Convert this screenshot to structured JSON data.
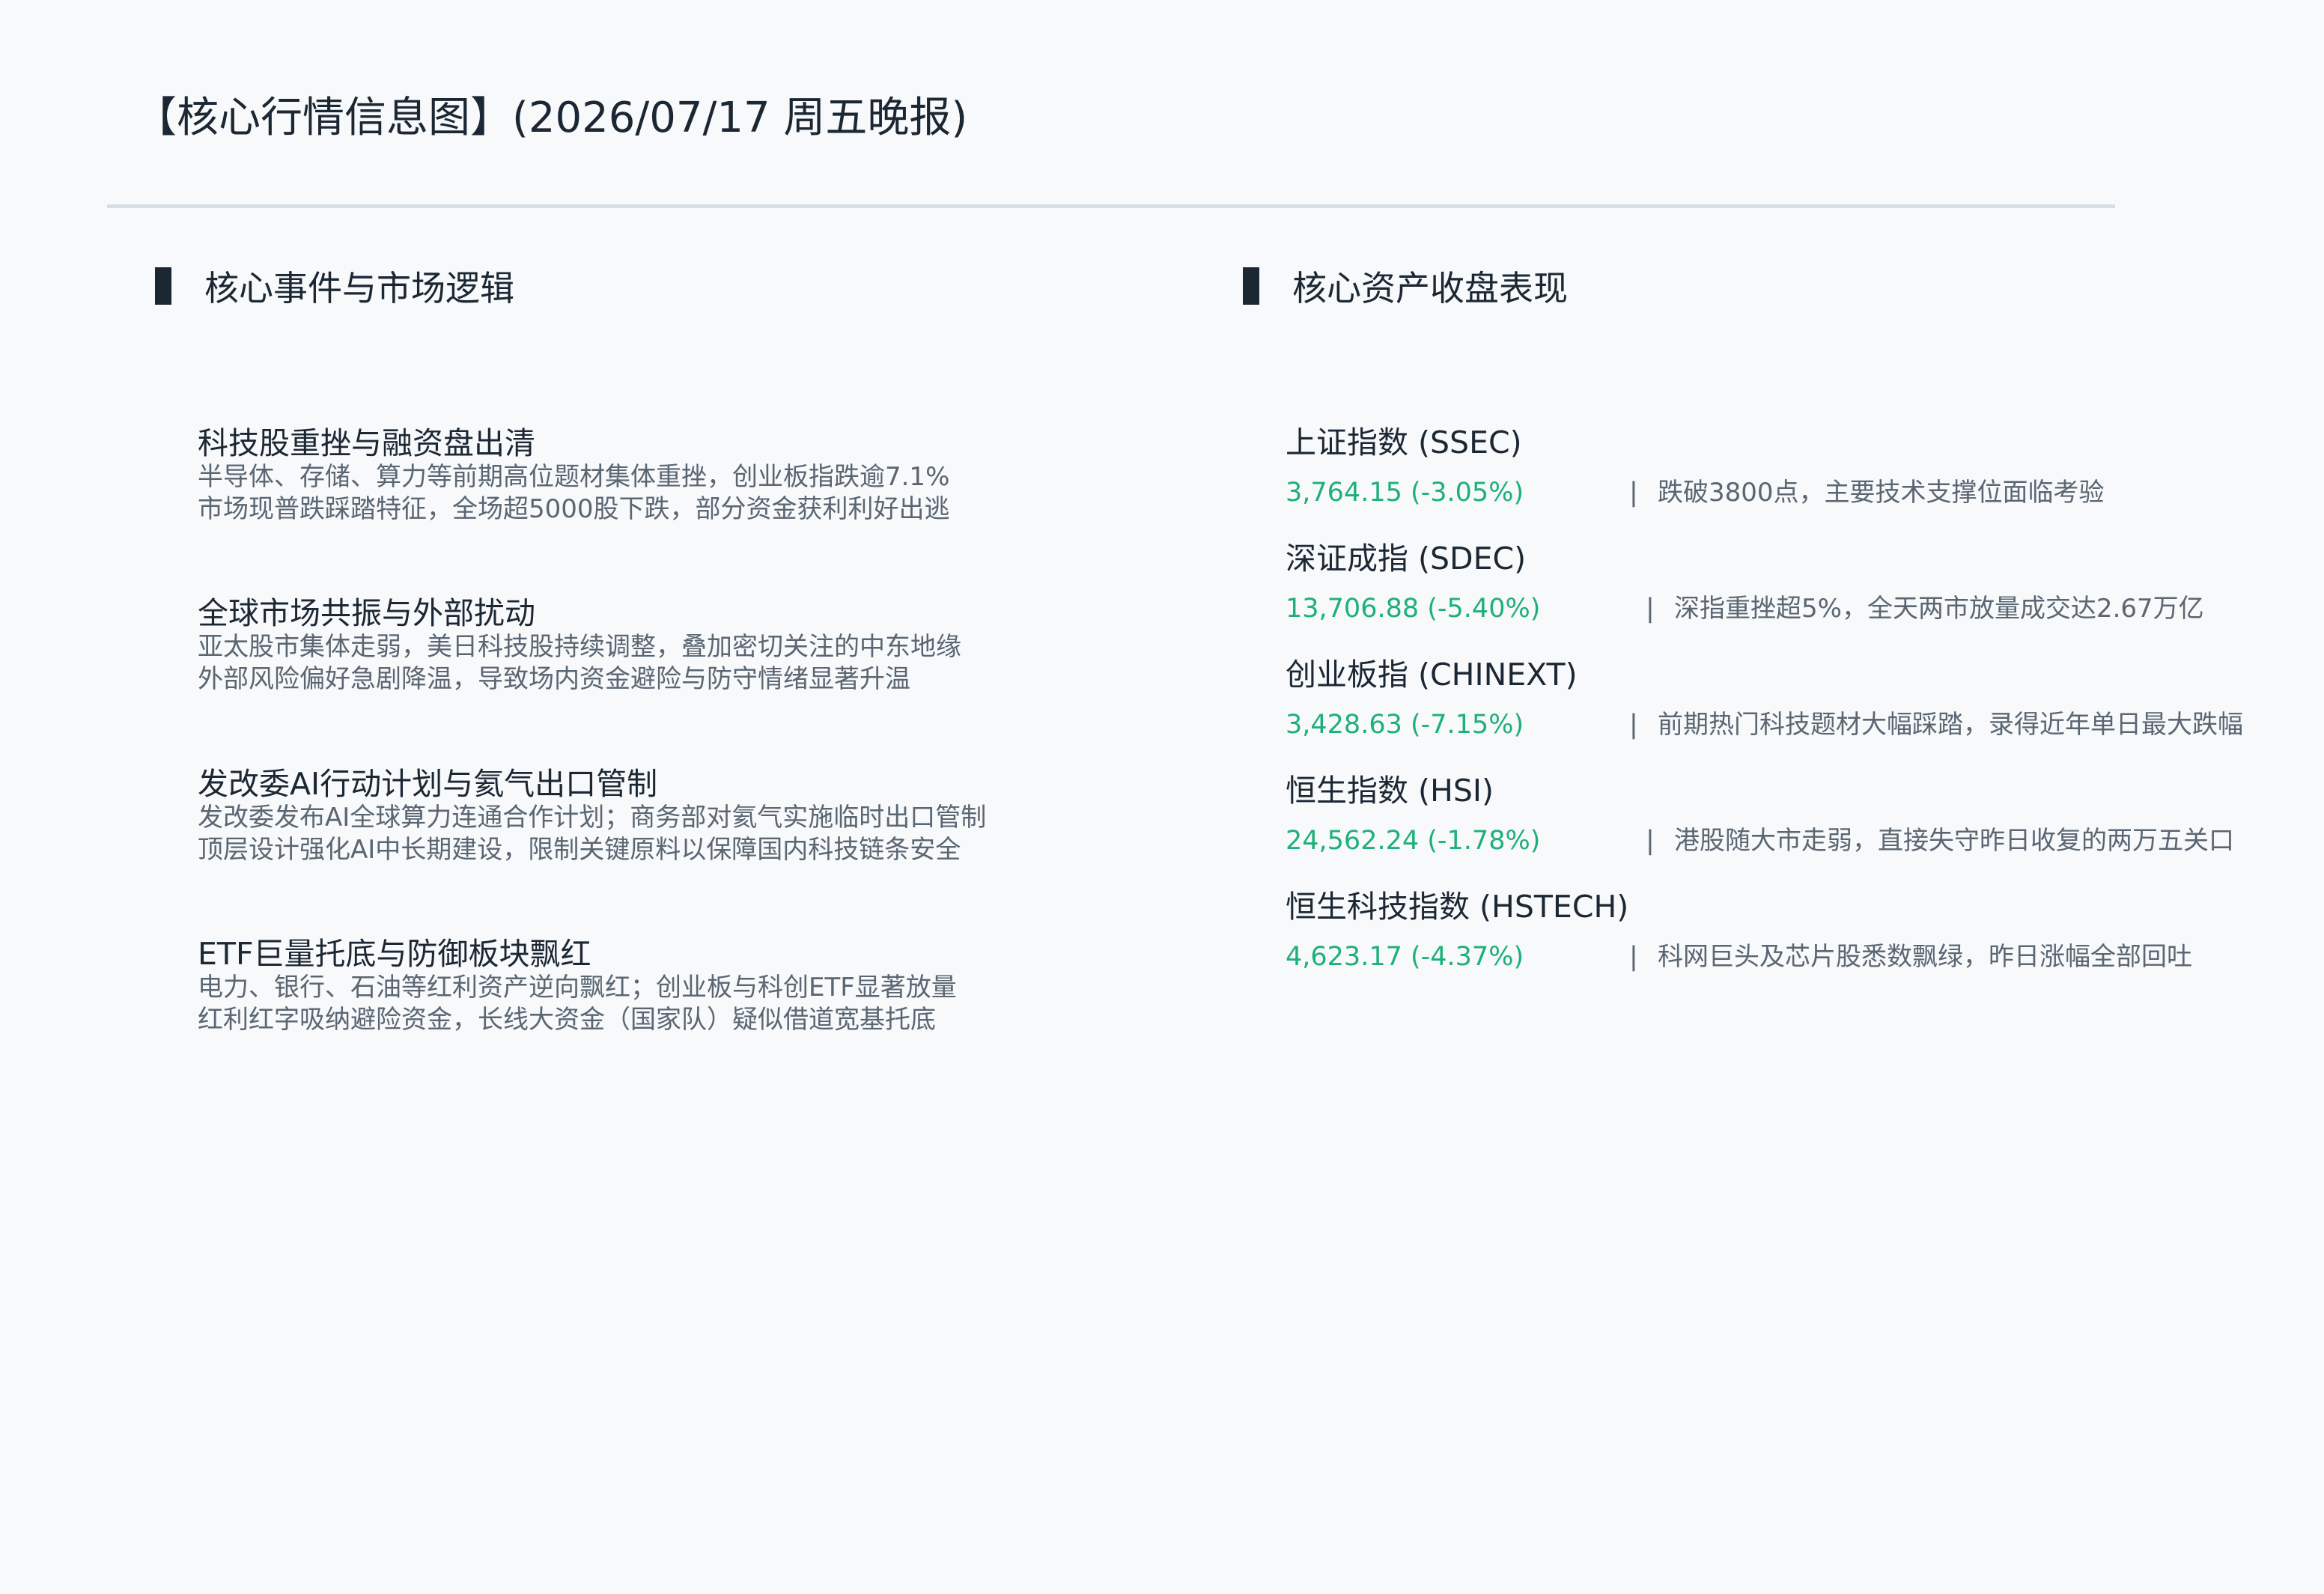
{
  "header": {
    "title": "【核心行情信息图】(2026/07/17 周五晚报)"
  },
  "left_section": {
    "heading": "核心事件与市场逻辑",
    "events": [
      {
        "title": "科技股重挫与融资盘出清",
        "lines": [
          "半导体、存储、算力等前期高位题材集体重挫，创业板指跌逾7.1%",
          "市场现普跌踩踏特征，全场超5000股下跌，部分资金获利利好出逃"
        ]
      },
      {
        "title": "全球市场共振与外部扰动",
        "lines": [
          "亚太股市集体走弱，美日科技股持续调整，叠加密切关注的中东地缘",
          "外部风险偏好急剧降温，导致场内资金避险与防守情绪显著升温"
        ]
      },
      {
        "title": "发改委AI行动计划与氦气出口管制",
        "lines": [
          "发改委发布AI全球算力连通合作计划；商务部对氦气实施临时出口管制",
          "顶层设计强化AI中长期建设，限制关键原料以保障国内科技链条安全"
        ]
      },
      {
        "title": "ETF巨量托底与防御板块飘红",
        "lines": [
          "电力、银行、石油等红利资产逆向飘红；创业板与科创ETF显著放量",
          "红利红字吸纳避险资金，长线大资金（国家队）疑似借道宽基托底"
        ]
      }
    ]
  },
  "right_section": {
    "heading": "核心资产收盘表现",
    "separator": "|",
    "assets": [
      {
        "name": "上证指数 (SSEC)",
        "value": "3,764.15 (-3.05%)",
        "note": "跌破3800点，主要技术支撑位面临考验"
      },
      {
        "name": "深证成指 (SDEC)",
        "value": "13,706.88 (-5.40%)",
        "note": "深指重挫超5%，全天两市放量成交达2.67万亿"
      },
      {
        "name": "创业板指 (CHINEXT)",
        "value": "3,428.63 (-7.15%)",
        "note": "前期热门科技题材大幅踩踏，录得近年单日最大跌幅"
      },
      {
        "name": "恒生指数 (HSI)",
        "value": "24,562.24 (-1.78%)",
        "note": "港股随大市走弱，直接失守昨日收复的两万五关口"
      },
      {
        "name": "恒生科技指数 (HSTECH)",
        "value": "4,623.17 (-4.37%)",
        "note": "科网巨头及芯片股悉数飘绿，昨日涨幅全部回吐"
      }
    ],
    "value_color": "#1fb079"
  }
}
